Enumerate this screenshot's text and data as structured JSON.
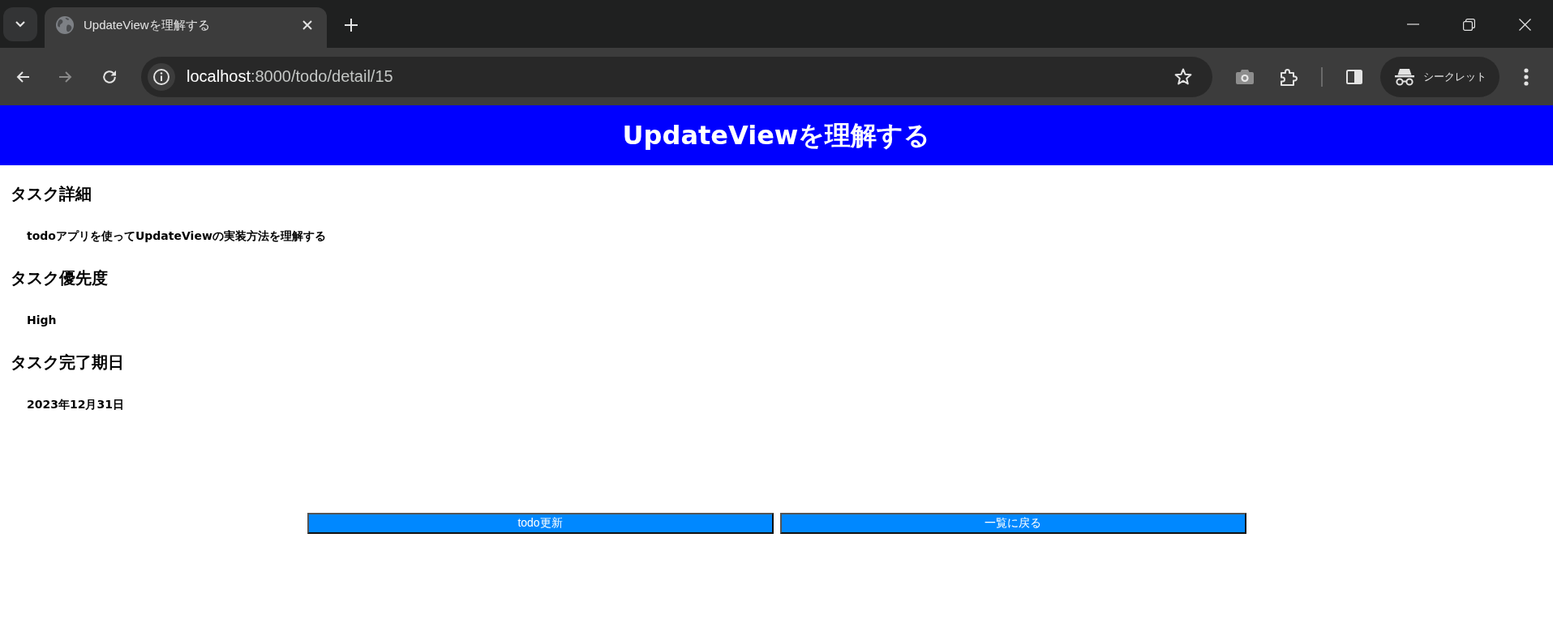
{
  "browser": {
    "tabs": [
      {
        "title": "UpdateViewを理解する",
        "selected": true
      }
    ],
    "navigation": [
      {
        "kind": "back",
        "disabled": false
      },
      {
        "kind": "forward",
        "disabled": true
      },
      {
        "kind": "reload",
        "disabled": false
      }
    ],
    "address_bar": {
      "host": "localhost",
      "path": ":8000/todo/detail/15"
    },
    "profile": {
      "label": "シークレット"
    }
  },
  "page": {
    "header": {
      "title": "UpdateViewを理解する"
    },
    "sections": [
      {
        "heading": "タスク詳細",
        "value": "todoアプリを使ってUpdateViewの実装方法を理解する"
      },
      {
        "heading": "タスク優先度",
        "value": "High"
      },
      {
        "heading": "タスク完了期日",
        "value": "2023年12月31日"
      }
    ],
    "buttons": [
      {
        "label": "todo更新"
      },
      {
        "label": "一覧に戻る"
      }
    ]
  }
}
